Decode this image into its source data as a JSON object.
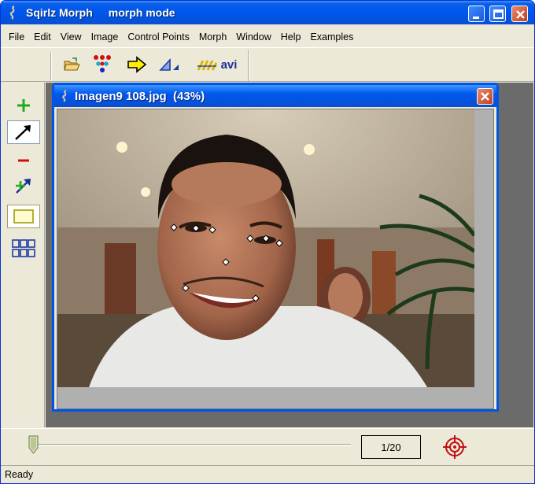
{
  "window": {
    "title": "Sqirlz Morph",
    "mode": "morph mode"
  },
  "menu": [
    "File",
    "Edit",
    "View",
    "Image",
    "Control Points",
    "Morph",
    "Window",
    "Help",
    "Examples"
  ],
  "toolbar": {
    "tools": [
      "open-folder-icon",
      "control-points-icon",
      "forward-arrow-icon",
      "triangle-grid-icon",
      "morph-lines-icon"
    ],
    "avi_label": "avi"
  },
  "left_tools": [
    "add-point-icon",
    "move-point-icon",
    "remove-point-icon",
    "move-all-points-icon",
    "select-rect-icon",
    "grid-icon"
  ],
  "left_tools_selected": "move-point-icon",
  "image_window": {
    "title": "Imagen9 108.jpg  (43%)",
    "control_point_count": 9
  },
  "frame_counter": "1/20",
  "slider_position": 0,
  "status": "Ready",
  "colors": {
    "title_blue": "#0054e3",
    "window_bg": "#ece9d8",
    "close_red": "#c43e1d"
  }
}
